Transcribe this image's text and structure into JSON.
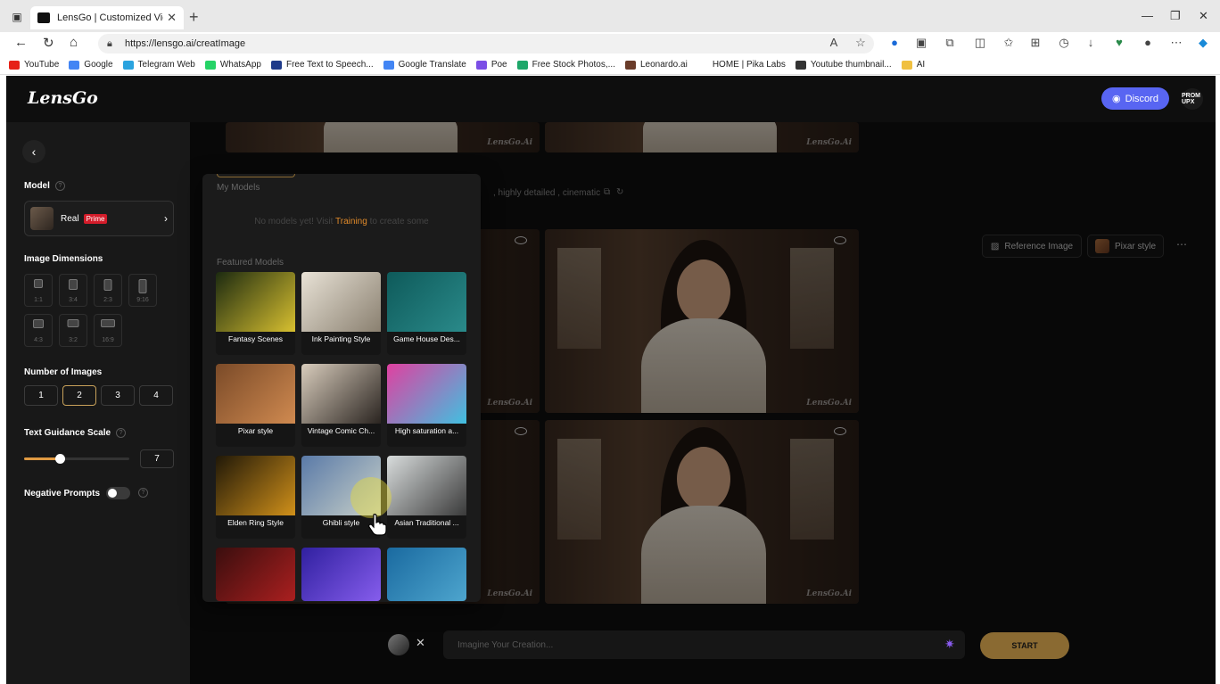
{
  "browser": {
    "tab_title": "LensGo | Customized Video Mak",
    "url": "https://lensgo.ai/creatImage",
    "bookmarks": [
      {
        "label": "YouTube",
        "color": "#e62117"
      },
      {
        "label": "Google",
        "color": "#4285f4"
      },
      {
        "label": "Telegram Web",
        "color": "#2aa3df"
      },
      {
        "label": "WhatsApp",
        "color": "#25d366"
      },
      {
        "label": "Free Text to Speech...",
        "color": "#1e3a8a"
      },
      {
        "label": "Google Translate",
        "color": "#4285f4"
      },
      {
        "label": "Poe",
        "color": "#7b4ee6"
      },
      {
        "label": "Free Stock Photos,...",
        "color": "#1ea76a"
      },
      {
        "label": "Leonardo.ai",
        "color": "#6a3c2a"
      },
      {
        "label": "HOME | Pika Labs",
        "color": "#ffffff"
      },
      {
        "label": "Youtube thumbnail...",
        "color": "#333333"
      },
      {
        "label": "AI",
        "color": "#f0c040"
      }
    ]
  },
  "app": {
    "logo": "LensGo",
    "discord_label": "Discord",
    "avatar_text": "PROM UPX"
  },
  "sidebar": {
    "model_label": "Model",
    "model_name": "Real",
    "model_badge": "Prime",
    "dimensions_label": "Image Dimensions",
    "dimensions": [
      "1:1",
      "3:4",
      "2:3",
      "9:16",
      "4:3",
      "3:2",
      "16:9"
    ],
    "num_images_label": "Number of Images",
    "num_images": [
      "1",
      "2",
      "3",
      "4"
    ],
    "num_images_selected": "2",
    "guidance_label": "Text Guidance Scale",
    "guidance_value": "7",
    "negative_label": "Negative Prompts"
  },
  "main": {
    "prompt_snippet": ", highly detailed , cinematic",
    "reference_label": "Reference Image",
    "style_label": "Pixar style",
    "watermark": "LensGo.Ai",
    "input_placeholder": "Imagine Your Creation...",
    "start_label": "START"
  },
  "popup": {
    "my_models_label": "My Models",
    "no_models_pre": "No models yet! Visit",
    "no_models_link": "Training",
    "no_models_post": "to create some",
    "featured_label": "Featured Models",
    "tiles": [
      {
        "label": "Fantasy Scenes",
        "c1": "#1c2a10",
        "c2": "#d8c030"
      },
      {
        "label": "Ink Painting Style",
        "c1": "#e8e2d6",
        "c2": "#8a8070"
      },
      {
        "label": "Game House Des...",
        "c1": "#0e5a5a",
        "c2": "#2a8a8a"
      },
      {
        "label": "Pixar style",
        "c1": "#7a4a28",
        "c2": "#d08a50"
      },
      {
        "label": "Vintage Comic Ch...",
        "c1": "#d8ccbc",
        "c2": "#2a2420"
      },
      {
        "label": "High saturation a...",
        "c1": "#e040a0",
        "c2": "#40c0e0"
      },
      {
        "label": "Elden Ring Style",
        "c1": "#201808",
        "c2": "#d0901a"
      },
      {
        "label": "Ghibli style",
        "c1": "#5a7aa8",
        "c2": "#c8d0c8"
      },
      {
        "label": "Asian Traditional ...",
        "c1": "#d8dcdc",
        "c2": "#3a3a3a"
      },
      {
        "label": "",
        "c1": "#3a0e0e",
        "c2": "#b02020"
      },
      {
        "label": "",
        "c1": "#3020a0",
        "c2": "#8a60f0"
      },
      {
        "label": "",
        "c1": "#1a6aa0",
        "c2": "#50a8d0"
      }
    ]
  }
}
